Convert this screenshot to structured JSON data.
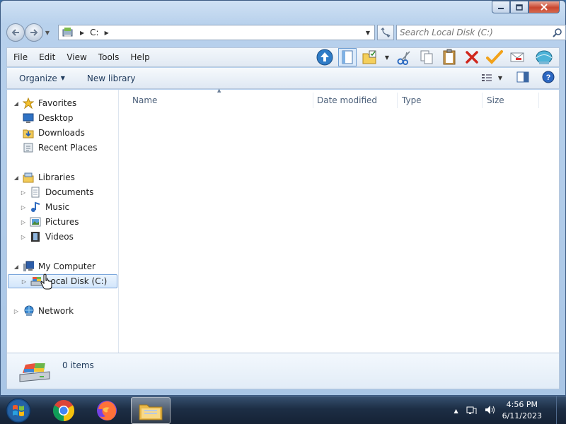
{
  "window": {
    "address": {
      "segment": "C:"
    },
    "search": {
      "placeholder": "Search Local Disk (C:)"
    }
  },
  "menu": [
    "File",
    "Edit",
    "View",
    "Tools",
    "Help"
  ],
  "commandbar": {
    "organize": "Organize",
    "new_library": "New library"
  },
  "nav": {
    "favorites": {
      "label": "Favorites",
      "items": [
        "Desktop",
        "Downloads",
        "Recent Places"
      ]
    },
    "libraries": {
      "label": "Libraries",
      "items": [
        "Documents",
        "Music",
        "Pictures",
        "Videos"
      ]
    },
    "computer": {
      "label": "My Computer",
      "items": [
        "Local Disk (C:)"
      ]
    },
    "network": {
      "label": "Network"
    }
  },
  "columns": [
    "Name",
    "Date modified",
    "Type",
    "Size"
  ],
  "details": {
    "count": "0 items"
  },
  "taskbar": {
    "apps": [
      "Windows Start",
      "Google Chrome",
      "Mozilla Firefox",
      "Windows Explorer"
    ],
    "clock": {
      "time": "4:56 PM",
      "date": "6/11/2023"
    }
  },
  "icons": {
    "back": "back-arrow-icon",
    "forward": "forward-arrow-icon",
    "refresh": "refresh-icon",
    "search": "magnifier-icon",
    "up": "up-arrow-icon",
    "cut": "scissors-icon",
    "copy": "copy-icon",
    "paste": "clipboard-icon",
    "delete": "red-x-icon",
    "properties": "checkmark-icon"
  }
}
